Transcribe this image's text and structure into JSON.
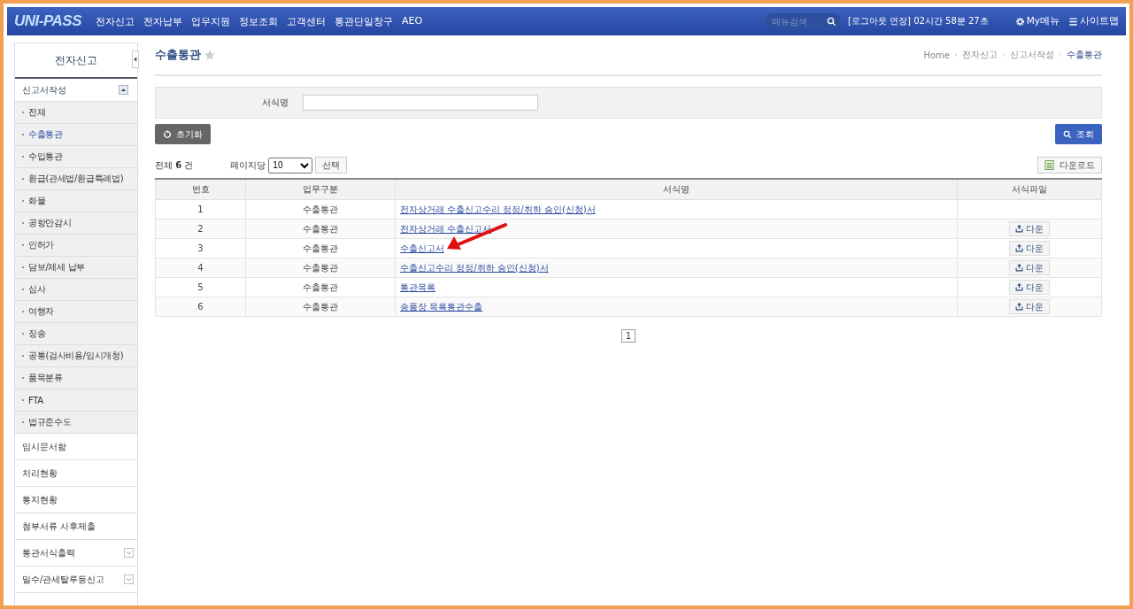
{
  "topbar": {
    "logo": "UNI-PASS",
    "menu": [
      "전자신고",
      "전자납부",
      "업무지원",
      "정보조회",
      "고객센터",
      "통관단일창구",
      "AEO"
    ],
    "search": {
      "placeholder": "메뉴검색"
    },
    "session": "[로그아웃 연장] 02시간 58분 27초",
    "my_menu": "My메뉴",
    "sitemap": "사이트맵"
  },
  "sidebar": {
    "title": "전자신고",
    "section": {
      "label": "신고서작성",
      "expanded": true,
      "items": [
        {
          "label": "전체",
          "selected": false
        },
        {
          "label": "수출통관",
          "selected": true
        },
        {
          "label": "수입통관",
          "selected": false
        },
        {
          "label": "환급(관세법/환급특례법)",
          "selected": false
        },
        {
          "label": "화물",
          "selected": false
        },
        {
          "label": "공항만감시",
          "selected": false
        },
        {
          "label": "인허가",
          "selected": false
        },
        {
          "label": "담보/체세 납부",
          "selected": false
        },
        {
          "label": "심사",
          "selected": false
        },
        {
          "label": "여행자",
          "selected": false
        },
        {
          "label": "징송",
          "selected": false
        },
        {
          "label": "공통(검사비용/임시개청)",
          "selected": false
        },
        {
          "label": "품목분류",
          "selected": false
        },
        {
          "label": "FTA",
          "selected": false
        },
        {
          "label": "법규준수도",
          "selected": false
        }
      ]
    },
    "items": [
      {
        "label": "임시문서함",
        "kind": "link"
      },
      {
        "label": "처리현황",
        "kind": "link"
      },
      {
        "label": "통지현황",
        "kind": "link"
      },
      {
        "label": "첨부서류 사후제출",
        "kind": "link"
      },
      {
        "label": "통관서식출력",
        "kind": "dropdown"
      },
      {
        "label": "밀수/관세탈루등신고",
        "kind": "dropdown"
      }
    ]
  },
  "page": {
    "title": "수출통관",
    "breadcrumb": [
      "Home",
      "전자신고",
      "신고서작성",
      "수출통관"
    ],
    "search": {
      "label": "서식명"
    },
    "reset_button": "초기화",
    "search_button": "조회",
    "total": {
      "prefix": "전체",
      "count": "6",
      "suffix": "건"
    },
    "per_page": {
      "label": "페이지당",
      "value": "10"
    },
    "select_button": "선택",
    "download_button": "다운로드",
    "table": {
      "columns": [
        "번호",
        "업무구분",
        "서식명",
        "서식파일"
      ],
      "rows": [
        {
          "no": "1",
          "type": "수출통관",
          "name": "전자상거래 수출신고수리 정정/취하 승인(신청)서"
        },
        {
          "no": "2",
          "type": "수출통관",
          "name": "전자상거래 수출신고서",
          "file": "다운"
        },
        {
          "no": "3",
          "type": "수출통관",
          "name": "수출신고서",
          "file": "다운"
        },
        {
          "no": "4",
          "type": "수출통관",
          "name": "수출신고수리 정정/취하 승인(신청)서",
          "file": "다운"
        },
        {
          "no": "5",
          "type": "수출통관",
          "name": "통관목록",
          "file": "다운"
        },
        {
          "no": "6",
          "type": "수출통관",
          "name": "송품장 목록통관수출",
          "file": "다운"
        }
      ]
    },
    "pages": [
      "1"
    ]
  }
}
